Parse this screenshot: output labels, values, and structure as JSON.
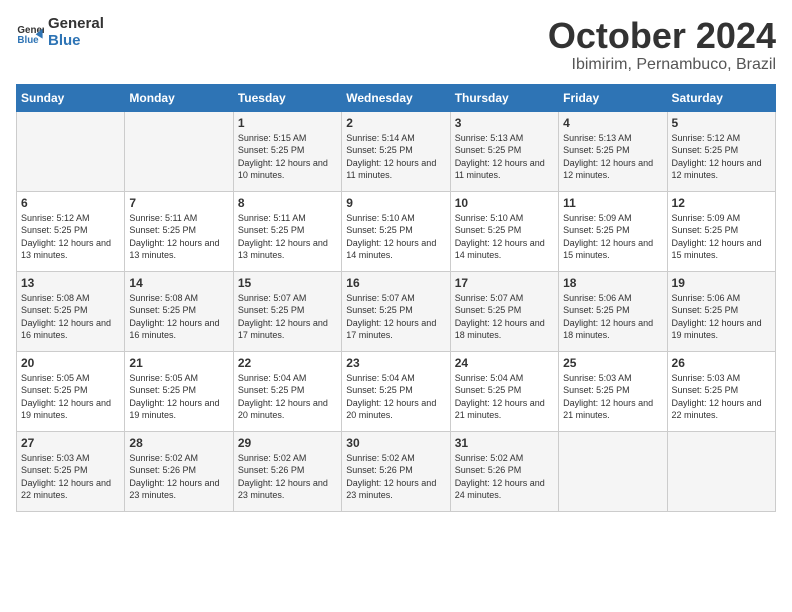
{
  "header": {
    "logo_line1": "General",
    "logo_line2": "Blue",
    "month": "October 2024",
    "location": "Ibimirim, Pernambuco, Brazil"
  },
  "weekdays": [
    "Sunday",
    "Monday",
    "Tuesday",
    "Wednesday",
    "Thursday",
    "Friday",
    "Saturday"
  ],
  "weeks": [
    [
      {
        "day": "",
        "sunrise": "",
        "sunset": "",
        "daylight": ""
      },
      {
        "day": "",
        "sunrise": "",
        "sunset": "",
        "daylight": ""
      },
      {
        "day": "1",
        "sunrise": "Sunrise: 5:15 AM",
        "sunset": "Sunset: 5:25 PM",
        "daylight": "Daylight: 12 hours and 10 minutes."
      },
      {
        "day": "2",
        "sunrise": "Sunrise: 5:14 AM",
        "sunset": "Sunset: 5:25 PM",
        "daylight": "Daylight: 12 hours and 11 minutes."
      },
      {
        "day": "3",
        "sunrise": "Sunrise: 5:13 AM",
        "sunset": "Sunset: 5:25 PM",
        "daylight": "Daylight: 12 hours and 11 minutes."
      },
      {
        "day": "4",
        "sunrise": "Sunrise: 5:13 AM",
        "sunset": "Sunset: 5:25 PM",
        "daylight": "Daylight: 12 hours and 12 minutes."
      },
      {
        "day": "5",
        "sunrise": "Sunrise: 5:12 AM",
        "sunset": "Sunset: 5:25 PM",
        "daylight": "Daylight: 12 hours and 12 minutes."
      }
    ],
    [
      {
        "day": "6",
        "sunrise": "Sunrise: 5:12 AM",
        "sunset": "Sunset: 5:25 PM",
        "daylight": "Daylight: 12 hours and 13 minutes."
      },
      {
        "day": "7",
        "sunrise": "Sunrise: 5:11 AM",
        "sunset": "Sunset: 5:25 PM",
        "daylight": "Daylight: 12 hours and 13 minutes."
      },
      {
        "day": "8",
        "sunrise": "Sunrise: 5:11 AM",
        "sunset": "Sunset: 5:25 PM",
        "daylight": "Daylight: 12 hours and 13 minutes."
      },
      {
        "day": "9",
        "sunrise": "Sunrise: 5:10 AM",
        "sunset": "Sunset: 5:25 PM",
        "daylight": "Daylight: 12 hours and 14 minutes."
      },
      {
        "day": "10",
        "sunrise": "Sunrise: 5:10 AM",
        "sunset": "Sunset: 5:25 PM",
        "daylight": "Daylight: 12 hours and 14 minutes."
      },
      {
        "day": "11",
        "sunrise": "Sunrise: 5:09 AM",
        "sunset": "Sunset: 5:25 PM",
        "daylight": "Daylight: 12 hours and 15 minutes."
      },
      {
        "day": "12",
        "sunrise": "Sunrise: 5:09 AM",
        "sunset": "Sunset: 5:25 PM",
        "daylight": "Daylight: 12 hours and 15 minutes."
      }
    ],
    [
      {
        "day": "13",
        "sunrise": "Sunrise: 5:08 AM",
        "sunset": "Sunset: 5:25 PM",
        "daylight": "Daylight: 12 hours and 16 minutes."
      },
      {
        "day": "14",
        "sunrise": "Sunrise: 5:08 AM",
        "sunset": "Sunset: 5:25 PM",
        "daylight": "Daylight: 12 hours and 16 minutes."
      },
      {
        "day": "15",
        "sunrise": "Sunrise: 5:07 AM",
        "sunset": "Sunset: 5:25 PM",
        "daylight": "Daylight: 12 hours and 17 minutes."
      },
      {
        "day": "16",
        "sunrise": "Sunrise: 5:07 AM",
        "sunset": "Sunset: 5:25 PM",
        "daylight": "Daylight: 12 hours and 17 minutes."
      },
      {
        "day": "17",
        "sunrise": "Sunrise: 5:07 AM",
        "sunset": "Sunset: 5:25 PM",
        "daylight": "Daylight: 12 hours and 18 minutes."
      },
      {
        "day": "18",
        "sunrise": "Sunrise: 5:06 AM",
        "sunset": "Sunset: 5:25 PM",
        "daylight": "Daylight: 12 hours and 18 minutes."
      },
      {
        "day": "19",
        "sunrise": "Sunrise: 5:06 AM",
        "sunset": "Sunset: 5:25 PM",
        "daylight": "Daylight: 12 hours and 19 minutes."
      }
    ],
    [
      {
        "day": "20",
        "sunrise": "Sunrise: 5:05 AM",
        "sunset": "Sunset: 5:25 PM",
        "daylight": "Daylight: 12 hours and 19 minutes."
      },
      {
        "day": "21",
        "sunrise": "Sunrise: 5:05 AM",
        "sunset": "Sunset: 5:25 PM",
        "daylight": "Daylight: 12 hours and 19 minutes."
      },
      {
        "day": "22",
        "sunrise": "Sunrise: 5:04 AM",
        "sunset": "Sunset: 5:25 PM",
        "daylight": "Daylight: 12 hours and 20 minutes."
      },
      {
        "day": "23",
        "sunrise": "Sunrise: 5:04 AM",
        "sunset": "Sunset: 5:25 PM",
        "daylight": "Daylight: 12 hours and 20 minutes."
      },
      {
        "day": "24",
        "sunrise": "Sunrise: 5:04 AM",
        "sunset": "Sunset: 5:25 PM",
        "daylight": "Daylight: 12 hours and 21 minutes."
      },
      {
        "day": "25",
        "sunrise": "Sunrise: 5:03 AM",
        "sunset": "Sunset: 5:25 PM",
        "daylight": "Daylight: 12 hours and 21 minutes."
      },
      {
        "day": "26",
        "sunrise": "Sunrise: 5:03 AM",
        "sunset": "Sunset: 5:25 PM",
        "daylight": "Daylight: 12 hours and 22 minutes."
      }
    ],
    [
      {
        "day": "27",
        "sunrise": "Sunrise: 5:03 AM",
        "sunset": "Sunset: 5:25 PM",
        "daylight": "Daylight: 12 hours and 22 minutes."
      },
      {
        "day": "28",
        "sunrise": "Sunrise: 5:02 AM",
        "sunset": "Sunset: 5:26 PM",
        "daylight": "Daylight: 12 hours and 23 minutes."
      },
      {
        "day": "29",
        "sunrise": "Sunrise: 5:02 AM",
        "sunset": "Sunset: 5:26 PM",
        "daylight": "Daylight: 12 hours and 23 minutes."
      },
      {
        "day": "30",
        "sunrise": "Sunrise: 5:02 AM",
        "sunset": "Sunset: 5:26 PM",
        "daylight": "Daylight: 12 hours and 23 minutes."
      },
      {
        "day": "31",
        "sunrise": "Sunrise: 5:02 AM",
        "sunset": "Sunset: 5:26 PM",
        "daylight": "Daylight: 12 hours and 24 minutes."
      },
      {
        "day": "",
        "sunrise": "",
        "sunset": "",
        "daylight": ""
      },
      {
        "day": "",
        "sunrise": "",
        "sunset": "",
        "daylight": ""
      }
    ]
  ]
}
